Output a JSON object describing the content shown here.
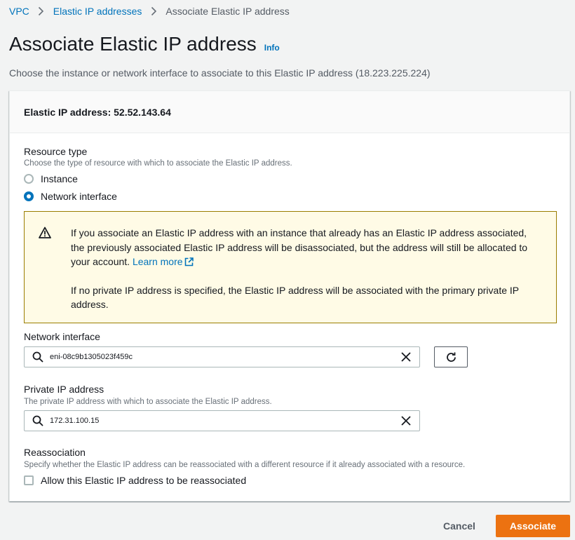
{
  "breadcrumb": {
    "items": [
      {
        "label": "VPC"
      },
      {
        "label": "Elastic IP addresses"
      },
      {
        "label": "Associate Elastic IP address"
      }
    ]
  },
  "header": {
    "title": "Associate Elastic IP address",
    "info_label": "Info",
    "description": "Choose the instance or network interface to associate to this Elastic IP address (18.223.225.224)"
  },
  "panel": {
    "title": "Elastic IP address: 52.52.143.64",
    "resource_type": {
      "label": "Resource type",
      "description": "Choose the type of resource with which to associate the Elastic IP address.",
      "options": [
        {
          "label": "Instance",
          "checked": false
        },
        {
          "label": "Network interface",
          "checked": true
        }
      ]
    },
    "alert": {
      "text_1": "If you associate an Elastic IP address with an instance that already has an Elastic IP address associated, the previously associated Elastic IP address will be disassociated, but the address will still be allocated to your account.",
      "learn_more": "Learn more",
      "text_2": "If no private IP address is specified, the Elastic IP address will be associated with the primary private IP address."
    },
    "network_interface": {
      "label": "Network interface",
      "value": "eni-08c9b1305023f459c"
    },
    "private_ip": {
      "label": "Private IP address",
      "description": "The private IP address with which to associate the Elastic IP address.",
      "value": "172.31.100.15"
    },
    "reassociation": {
      "label": "Reassociation",
      "description": "Specify whether the Elastic IP address can be reassociated with a different resource if it already associated with a resource.",
      "checkbox_label": "Allow this Elastic IP address to be reassociated",
      "checked": false
    }
  },
  "footer": {
    "cancel_label": "Cancel",
    "associate_label": "Associate"
  },
  "colors": {
    "link": "#0073bb",
    "primary_button": "#ec7211",
    "warning_bg": "#fffbe6",
    "warning_border": "#9a7d00"
  }
}
